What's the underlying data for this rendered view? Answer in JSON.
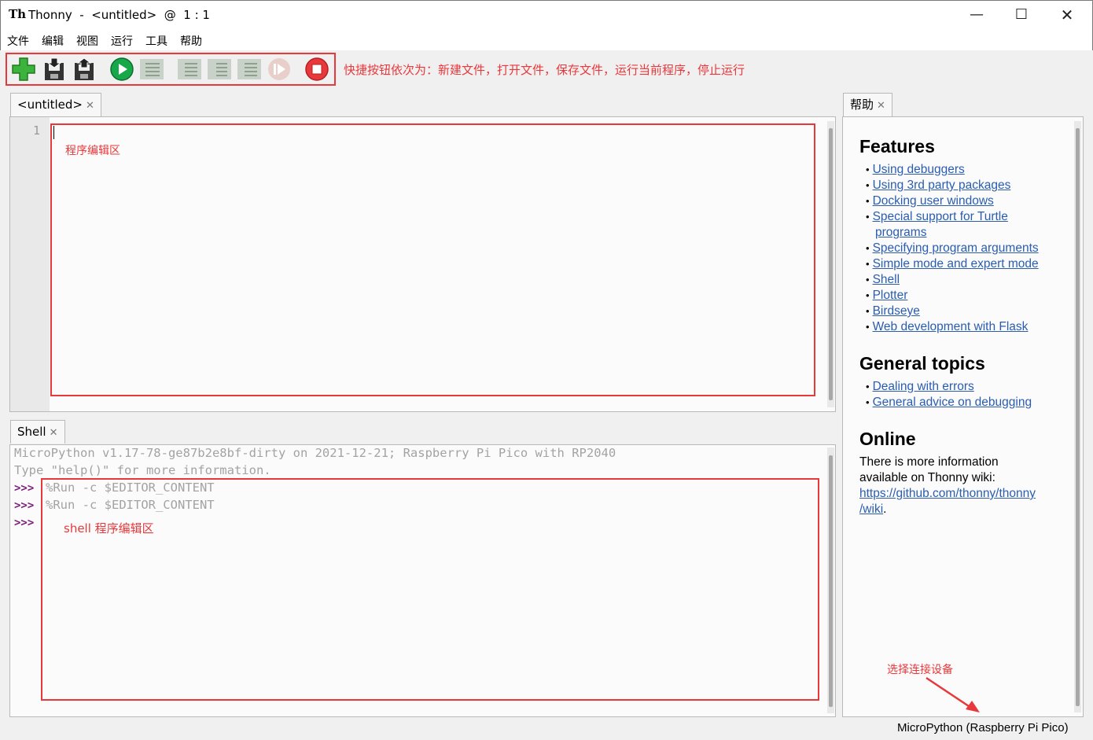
{
  "window": {
    "title": "Thonny  -  <untitled>  @  1 : 1",
    "logo": "Th",
    "min_glyph": "—",
    "max_glyph": "☐",
    "close_glyph": "✕"
  },
  "menu": [
    "文件",
    "编辑",
    "视图",
    "运行",
    "工具",
    "帮助"
  ],
  "toolbar": {
    "buttons": [
      "new-file",
      "open-file",
      "save-file",
      "run-current-script",
      "debug-current-script",
      "step-over",
      "step-into",
      "step-out",
      "resume",
      "stop"
    ],
    "note": "快捷按钮依次为：新建文件，打开文件，保存文件，运行当前程序，停止运行"
  },
  "editor": {
    "tab_label": "<untitled>",
    "tab_close": "✕",
    "line_number": "1",
    "annotation": "程序编辑区"
  },
  "shell": {
    "tab_label": "Shell",
    "tab_close": "✕",
    "banner1": "MicroPython v1.17-78-ge87b2e8bf-dirty on 2021-12-21; Raspberry Pi Pico with RP2040",
    "banner2": "Type \"help()\" for more information.",
    "prompt": ">>>",
    "cmd1": "%Run -c $EDITOR_CONTENT",
    "cmd2": "%Run -c $EDITOR_CONTENT",
    "annotation": "shell 程序编辑区"
  },
  "help": {
    "tab_label": "帮助",
    "tab_close": "✕",
    "bullet": "•",
    "features_title": "Features",
    "features": [
      "Using debuggers",
      "Using 3rd party packages",
      "Docking user windows",
      "Special support for Turtle ",
      "programs",
      "Specifying program arguments",
      "Simple mode and expert mode",
      "Shell",
      "Plotter",
      "Birdseye",
      "Web development with Flask"
    ],
    "general_title": "General topics",
    "general": [
      "Dealing with errors",
      "General advice on debugging"
    ],
    "online_title": "Online",
    "online_text1": "There is more information",
    "online_text2": "available on Thonny wiki:",
    "online_link1": "https://github.com/thonny/thonny",
    "online_link2": "/wiki",
    "online_period": "."
  },
  "annotations": {
    "device": "选择连接设备"
  },
  "status": {
    "interpreter": "MicroPython (Raspberry Pi Pico)"
  },
  "colors": {
    "annotation_red": "#e8383b",
    "link_blue": "#2a5db0",
    "prompt_purple": "#7b1e7a",
    "run_green": "#17a84a"
  }
}
